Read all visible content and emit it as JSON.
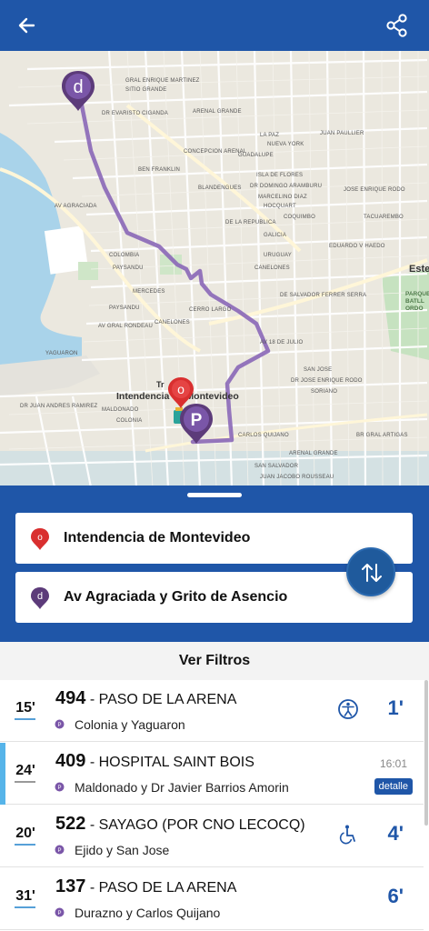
{
  "header": {
    "back_icon": "arrow-left-icon",
    "share_icon": "share-icon",
    "color": "#1f56a8"
  },
  "map": {
    "origin_marker_letter": "o",
    "destination_marker_letter": "d",
    "stop_marker_letter": "P",
    "place_label": "Intendencia de Montevideo",
    "place_prefix": "Tr",
    "area_label": "Este",
    "park_label_1": "PARQUE",
    "park_label_2": "BATLL",
    "park_label_3": "ORDO",
    "route_color": "#8a67b7",
    "streets": [
      "GRAL ENRIQUE MARTINEZ",
      "SITIO GRANDE",
      "DR EVARISTO CIGANDA",
      "ARENAL GRANDE",
      "CONCEPCION ARENAL",
      "BLANDENGUES",
      "BEN FRANKLIN",
      "LA PAZ",
      "NUEVA YORK",
      "ISLA DE FLORES",
      "DR DOMINGO ARAMBURU",
      "MARCELINO DIAZ",
      "GUADALUPE",
      "HOCQUART",
      "COQUIMBO",
      "GALICIA",
      "URUGUAY",
      "CANELONES",
      "DE LA REPUBLICA",
      "COLOMBIA",
      "PAYSANDU",
      "MERCEDES",
      "CERRO LARGO",
      "DE SALVADOR FERRER SERRA",
      "AV 18 DE JULIO",
      "SAN JOSE",
      "DR JOSE ENRIQUE RODO",
      "SORIANO",
      "CARLOS QUIJANO",
      "SAN SALVADOR",
      "ARENAL GRANDE",
      "JUAN JACOBO ROUSSEAU",
      "PAYSANDU",
      "AV GRAL RONDEAU",
      "CANELONES",
      "MALDONADO",
      "COLONIA",
      "AV AGRACIADA",
      "YAGUARON",
      "DR JUAN ANDRES RAMIREZ",
      "JUAN PAULLIER",
      "EDUARDO V HAEDO",
      "JOSE ENRIQUE RODO",
      "BR GRAL ARTIGAS",
      "TACUAREMBO"
    ]
  },
  "search": {
    "origin": "Intendencia de Montevideo",
    "destination": "Av Agraciada y Grito de Asencio",
    "origin_pin_letter": "o",
    "destination_pin_letter": "d",
    "origin_pin_color": "#d92f2f",
    "destination_pin_color": "#5c3b7a",
    "swap_icon": "swap-vertical-icon"
  },
  "filters_label": "Ver Filtros",
  "results": [
    {
      "frequency": "15'",
      "number": "494",
      "separator": " - ",
      "destination": "PASO DE LA ARENA",
      "stop": "Colonia y Yaguaron",
      "eta": "1'",
      "feature_icon": "accessibility-wheel-icon",
      "selected": false
    },
    {
      "frequency": "24'",
      "number": "409",
      "separator": " - ",
      "destination": "HOSPITAL SAINT BOIS",
      "stop": "Maldonado y Dr Javier Barrios Amorin",
      "time": "16:01",
      "detail_label": "detalle",
      "selected": true
    },
    {
      "frequency": "20'",
      "number": "522",
      "separator": " - ",
      "destination": "SAYAGO (POR CNO LECOCQ)",
      "stop": "Ejido y San Jose",
      "eta": "4'",
      "feature_icon": "wheelchair-icon",
      "selected": false
    },
    {
      "frequency": "31'",
      "number": "137",
      "separator": " - ",
      "destination": "PASO DE LA ARENA",
      "stop": "Durazno y Carlos Quijano",
      "eta": "6'",
      "selected": false
    }
  ]
}
